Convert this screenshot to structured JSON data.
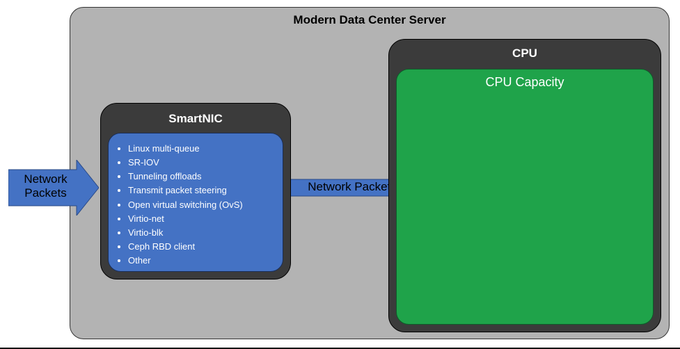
{
  "server": {
    "title": "Modern Data Center Server"
  },
  "arrow_in": {
    "label_line1": "Network",
    "label_line2": "Packets"
  },
  "arrow_mid": {
    "label": "Network Packets"
  },
  "smartnic": {
    "title": "SmartNIC",
    "features": [
      "Linux multi-queue",
      "SR-IOV",
      "Tunneling offloads",
      "Transmit packet steering",
      "Open virtual switching (OvS)",
      "Virtio-net",
      "Virtio-blk",
      "Ceph RBD client",
      "Other"
    ]
  },
  "cpu": {
    "title": "CPU",
    "capacity_label": "CPU Capacity"
  },
  "colors": {
    "server_bg": "#b3b3b3",
    "dark_frame": "#3b3b3b",
    "blue": "#4472c4",
    "green": "#1fa34a"
  }
}
